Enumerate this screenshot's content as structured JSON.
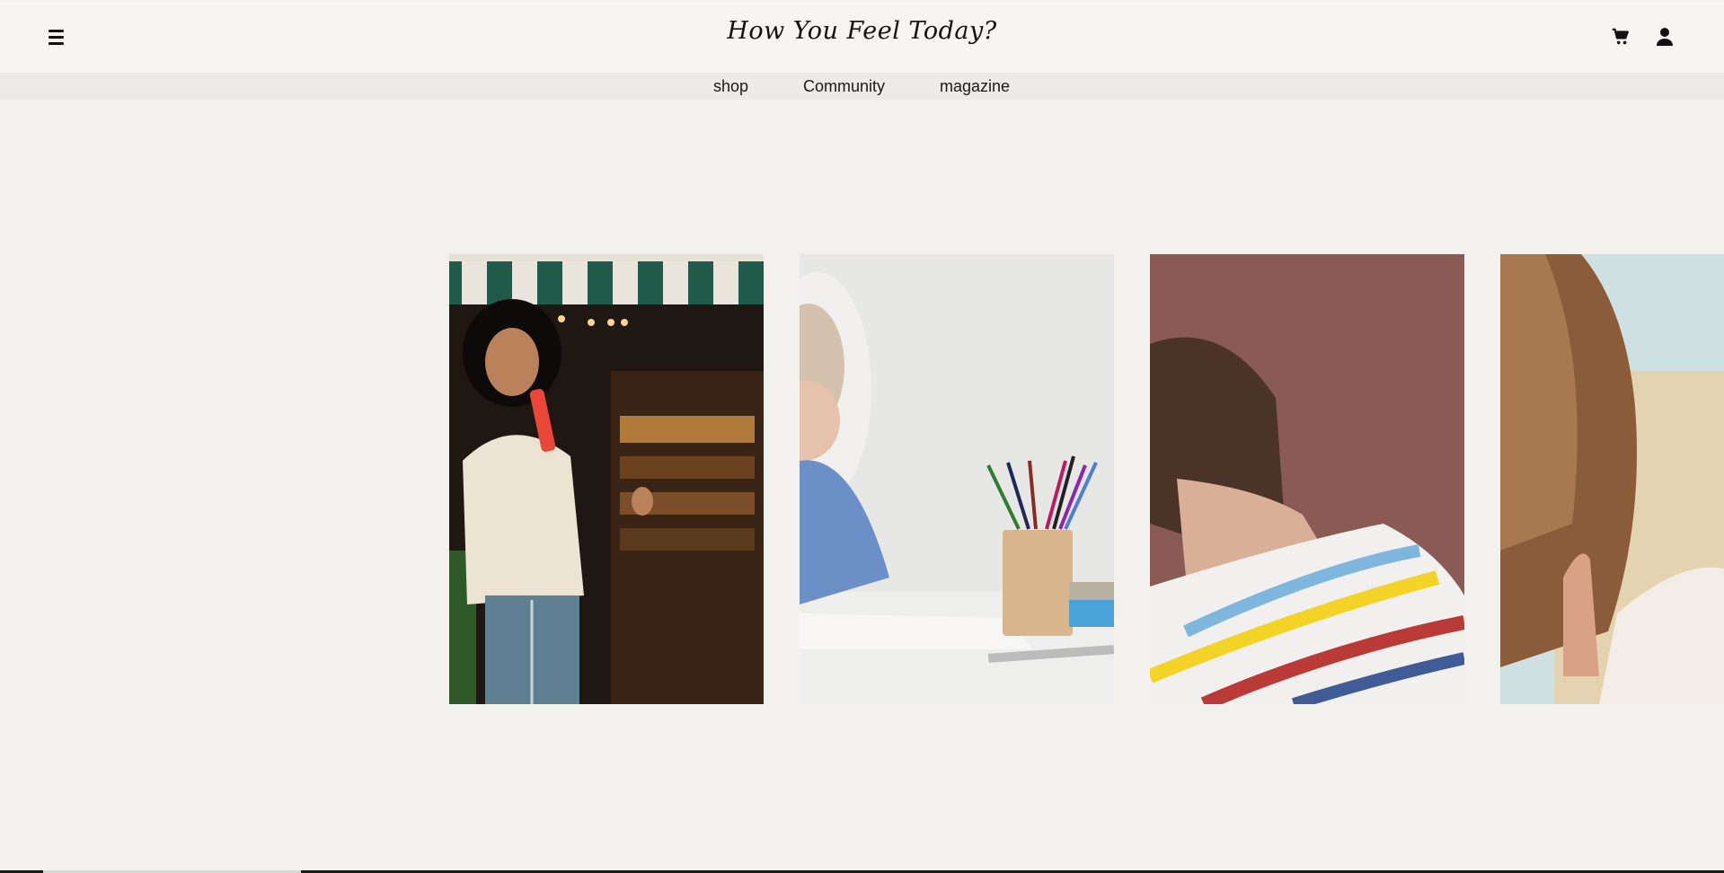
{
  "header": {
    "logo_text": "How You Feel Today?",
    "menu_icon": "hamburger-icon",
    "cart_icon": "cart-icon",
    "account_icon": "user-icon"
  },
  "nav": {
    "items": [
      {
        "label": "shop"
      },
      {
        "label": "Community"
      },
      {
        "label": "magazine"
      }
    ]
  },
  "gallery": {
    "cards": [
      {
        "subject": "woman-laughing-with-drink"
      },
      {
        "subject": "child-with-colored-pencils"
      },
      {
        "subject": "boy-in-striped-shirt"
      },
      {
        "subject": "woman-long-hair"
      }
    ],
    "scroll_position": 0.03
  },
  "colors": {
    "background": "#f2f1ee",
    "header_bg": "#f7f5f1",
    "nav_bg": "#ecebe8",
    "text": "#1a1a1a"
  }
}
